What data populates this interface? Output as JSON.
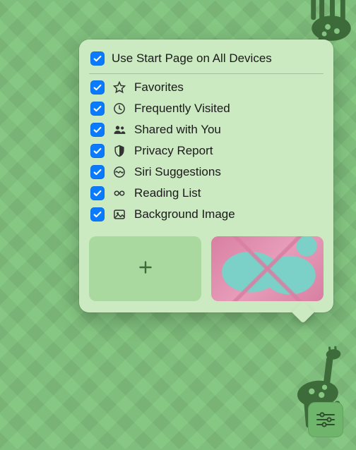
{
  "popover": {
    "header": {
      "label": "Use Start Page on All Devices",
      "checked": true
    },
    "items": [
      {
        "icon": "star-icon",
        "label": "Favorites",
        "checked": true
      },
      {
        "icon": "clock-icon",
        "label": "Frequently Visited",
        "checked": true
      },
      {
        "icon": "people-icon",
        "label": "Shared with You",
        "checked": true
      },
      {
        "icon": "shield-icon",
        "label": "Privacy Report",
        "checked": true
      },
      {
        "icon": "siri-icon",
        "label": "Siri Suggestions",
        "checked": true
      },
      {
        "icon": "glasses-icon",
        "label": "Reading List",
        "checked": true
      },
      {
        "icon": "image-icon",
        "label": "Background Image",
        "checked": true
      }
    ],
    "thumbnails": {
      "add_label": "+",
      "selected": "butterfly"
    }
  },
  "colors": {
    "accent": "#0a7bff",
    "popover_bg": "#cceac1",
    "wallpaper": "#86c883"
  }
}
